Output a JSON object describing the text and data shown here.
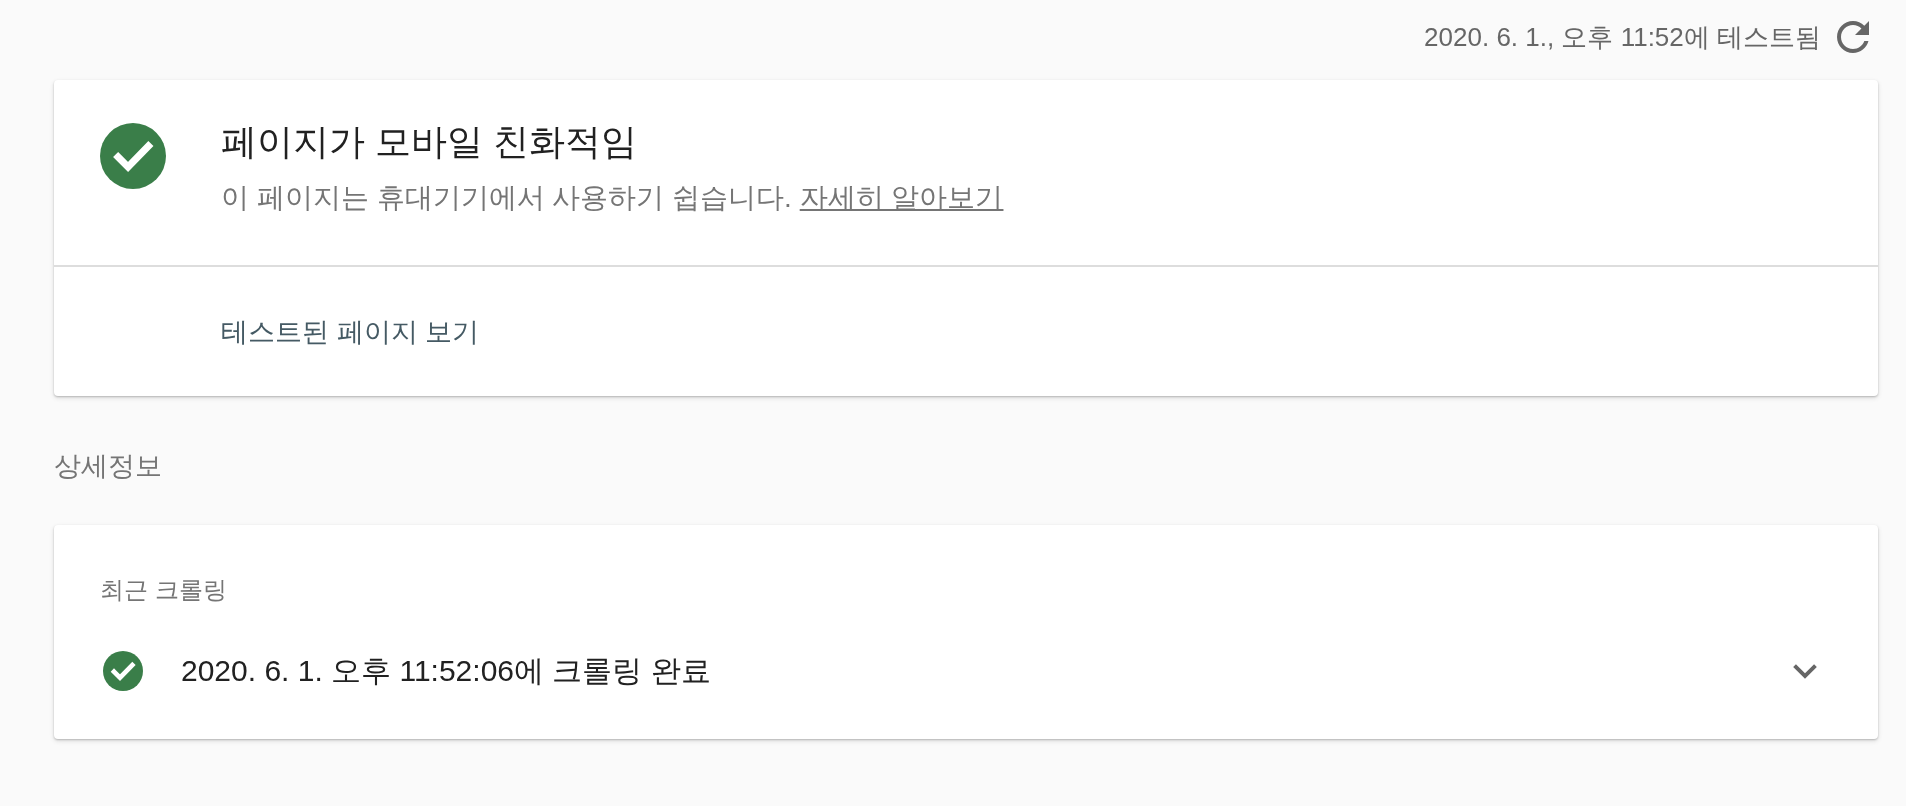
{
  "header": {
    "tested_at": "2020. 6. 1., 오후 11:52에 테스트됨"
  },
  "verdict": {
    "passed": true,
    "title": "페이지가 모바일 친화적임",
    "description": "이 페이지는 휴대기기에서 사용하기 쉽습니다.",
    "link": "자세히 알아보기",
    "action": "테스트된 페이지 보기"
  },
  "details": {
    "heading": "상세정보",
    "cards": [
      {
        "label": "최근 크롤링",
        "passed": true,
        "text": "2020. 6. 1. 오후 11:52:06에 크롤링 완료",
        "expanded": false
      }
    ]
  }
}
